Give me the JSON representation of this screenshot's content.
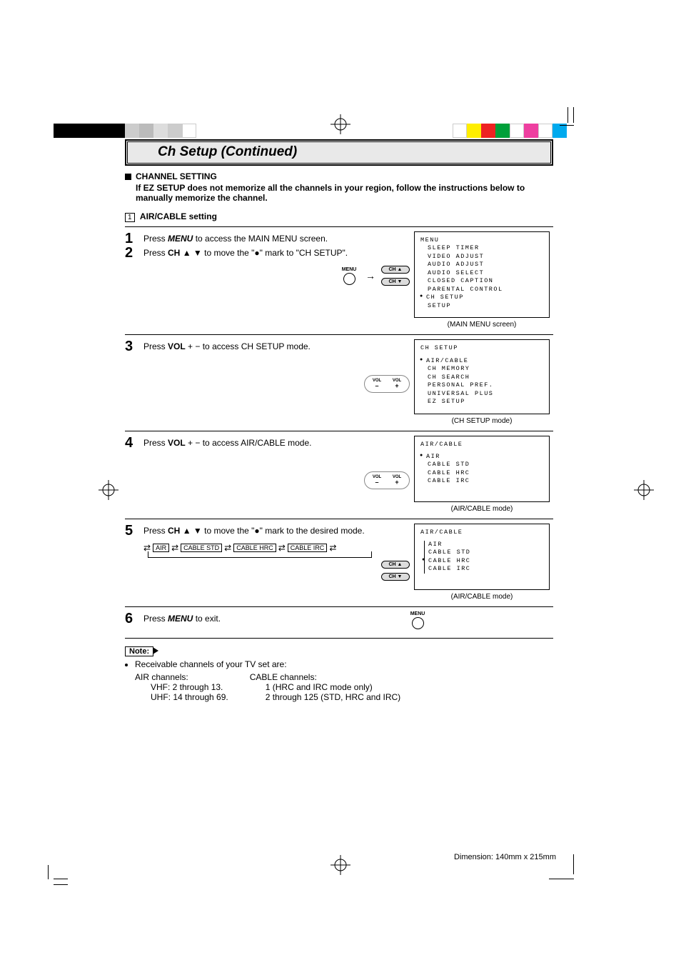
{
  "title": "Ch Setup (Continued)",
  "intro": {
    "heading": "CHANNEL SETTING",
    "sub": "If EZ SETUP does not memorize all the channels in your region, follow the instructions below to manually memorize the channel."
  },
  "subsection": {
    "num": "1",
    "label": "AIR/CABLE setting"
  },
  "keys": {
    "menu": "MENU",
    "ch_up": "CH ▲",
    "ch_dn": "CH ▼",
    "vol": "VOL",
    "minus": "–",
    "plus": "+"
  },
  "steps": {
    "s1": {
      "n": "1",
      "t1": "Press ",
      "menu": "MENU",
      "t2": " to access the MAIN MENU screen."
    },
    "s2": {
      "n": "2",
      "t1": "Press ",
      "ch": "CH",
      "arrows": "▲ ▼",
      "t2": " to move the \"●\" mark to \"CH SETUP\"."
    },
    "s3": {
      "n": "3",
      "t1": "Press ",
      "vol": "VOL",
      "pm": "+  −",
      "t2": " to access CH SETUP mode."
    },
    "s4": {
      "n": "4",
      "t1": "Press ",
      "vol": "VOL",
      "pm": "+  −",
      "t2": " to access AIR/CABLE mode."
    },
    "s5": {
      "n": "5",
      "t1": "Press ",
      "ch": "CH",
      "arrows": "▲ ▼",
      "t2": " to move the \"●\" mark to the desired mode."
    },
    "s6": {
      "n": "6",
      "t1": "Press ",
      "menu": "MENU",
      "t2": " to exit."
    }
  },
  "cycle": {
    "a": "AIR",
    "b": "CABLE STD",
    "c": "CABLE HRC",
    "d": "CABLE IRC"
  },
  "screens": {
    "menu": {
      "title": "MENU",
      "items": [
        "SLEEP TIMER",
        "VIDEO ADJUST",
        "AUDIO ADJUST",
        "AUDIO SELECT",
        "CLOSED CAPTION",
        "PARENTAL CONTROL",
        "CH SETUP",
        "SETUP"
      ],
      "sel": 6,
      "caption": "(MAIN MENU screen)"
    },
    "chsetup": {
      "title": "CH SETUP",
      "items": [
        "AIR/CABLE",
        "CH MEMORY",
        "CH SEARCH",
        "PERSONAL PREF.",
        "UNIVERSAL PLUS",
        "EZ SETUP"
      ],
      "sel": 0,
      "caption": "(CH SETUP mode)"
    },
    "aircable1": {
      "title": "AIR/CABLE",
      "items": [
        "AIR",
        "CABLE STD",
        "CABLE HRC",
        "CABLE IRC"
      ],
      "sel": 0,
      "caption": "(AIR/CABLE mode)"
    },
    "aircable2": {
      "title": "AIR/CABLE",
      "items": [
        "AIR",
        "CABLE STD",
        "CABLE HRC",
        "CABLE IRC"
      ],
      "sel": 2,
      "caption": "(AIR/CABLE mode)"
    }
  },
  "note": {
    "label": "Note:",
    "lead": "Receivable channels of your TV set are:",
    "air_h": "AIR channels:",
    "air_l1": "VHF: 2 through 13.",
    "air_l2": "UHF: 14 through 69.",
    "cab_h": "CABLE channels:",
    "cab_l1": "1 (HRC and IRC mode only)",
    "cab_l2": "2 through 125 (STD, HRC and IRC)"
  },
  "dimension": "Dimension: 140mm x 215mm",
  "colors": {
    "tl": [
      "#000",
      "#000",
      "#000",
      "#000",
      "#000",
      "#ccc",
      "#ccc",
      "#ccc",
      "#ccc",
      "#fff"
    ],
    "tr": [
      "#00aaee",
      "#ee3fa0",
      "#ffee00",
      "#ee2222",
      "#00a03a",
      "#fff",
      "#000",
      "#fff"
    ]
  }
}
